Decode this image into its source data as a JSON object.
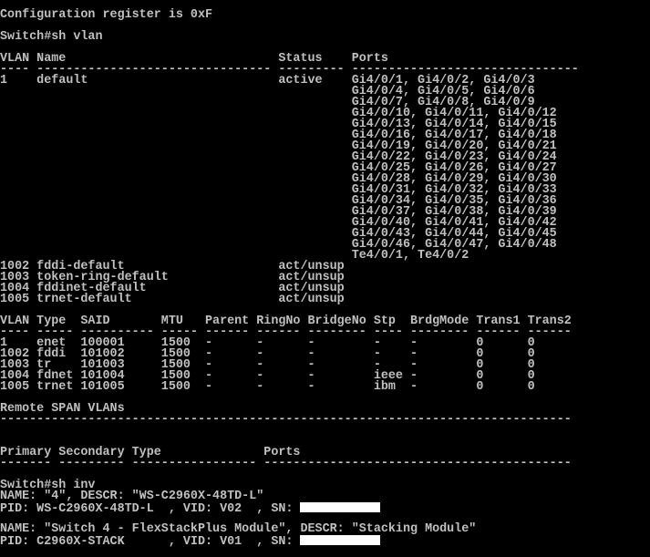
{
  "colors": {
    "background": "#000000",
    "foreground": "#c0c0c0",
    "redaction": "#ffffff"
  },
  "lines": [
    "Configuration register is 0xF",
    "",
    "Switch#sh vlan",
    "",
    "VLAN Name                             Status    Ports",
    "---- -------------------------------- --------- -------------------------------",
    "1    default                          active    Gi4/0/1, Gi4/0/2, Gi4/0/3",
    "                                                Gi4/0/4, Gi4/0/5, Gi4/0/6",
    "                                                Gi4/0/7, Gi4/0/8, Gi4/0/9",
    "                                                Gi4/0/10, Gi4/0/11, Gi4/0/12",
    "                                                Gi4/0/13, Gi4/0/14, Gi4/0/15",
    "                                                Gi4/0/16, Gi4/0/17, Gi4/0/18",
    "                                                Gi4/0/19, Gi4/0/20, Gi4/0/21",
    "                                                Gi4/0/22, Gi4/0/23, Gi4/0/24",
    "                                                Gi4/0/25, Gi4/0/26, Gi4/0/27",
    "                                                Gi4/0/28, Gi4/0/29, Gi4/0/30",
    "                                                Gi4/0/31, Gi4/0/32, Gi4/0/33",
    "                                                Gi4/0/34, Gi4/0/35, Gi4/0/36",
    "                                                Gi4/0/37, Gi4/0/38, Gi4/0/39",
    "                                                Gi4/0/40, Gi4/0/41, Gi4/0/42",
    "                                                Gi4/0/43, Gi4/0/44, Gi4/0/45",
    "                                                Gi4/0/46, Gi4/0/47, Gi4/0/48",
    "                                                Te4/0/1, Te4/0/2",
    "1002 fddi-default                     act/unsup",
    "1003 token-ring-default               act/unsup",
    "1004 fddinet-default                  act/unsup",
    "1005 trnet-default                    act/unsup",
    "",
    "VLAN Type  SAID       MTU   Parent RingNo BridgeNo Stp  BrdgMode Trans1 Trans2",
    "---- ----- ---------- ----- ------ ------ -------- ---- -------- ------ ------",
    "1    enet  100001     1500  -      -      -        -    -        0      0",
    "1002 fddi  101002     1500  -      -      -        -    -        0      0",
    "1003 tr    101003     1500  -      -      -        -    -        0      0",
    "1004 fdnet 101004     1500  -      -      -        ieee -        0      0",
    "1005 trnet 101005     1500  -      -      -        ibm  -        0      0",
    "",
    "Remote SPAN VLANs",
    "------------------------------------------------------------------------------",
    "",
    "",
    "Primary Secondary Type              Ports",
    "------- --------- ----------------- ------------------------------------------",
    "",
    "Switch#sh inv",
    "NAME: \"4\", DESCR: \"WS-C2960X-48TD-L\"",
    "PID: WS-C2960X-48TD-L  , VID: V02  , SN: ",
    "",
    "NAME: \"Switch 4 - FlexStackPlus Module\", DESCR: \"Stacking Module\"",
    "PID: C2960X-STACK      , VID: V01  , SN: "
  ]
}
